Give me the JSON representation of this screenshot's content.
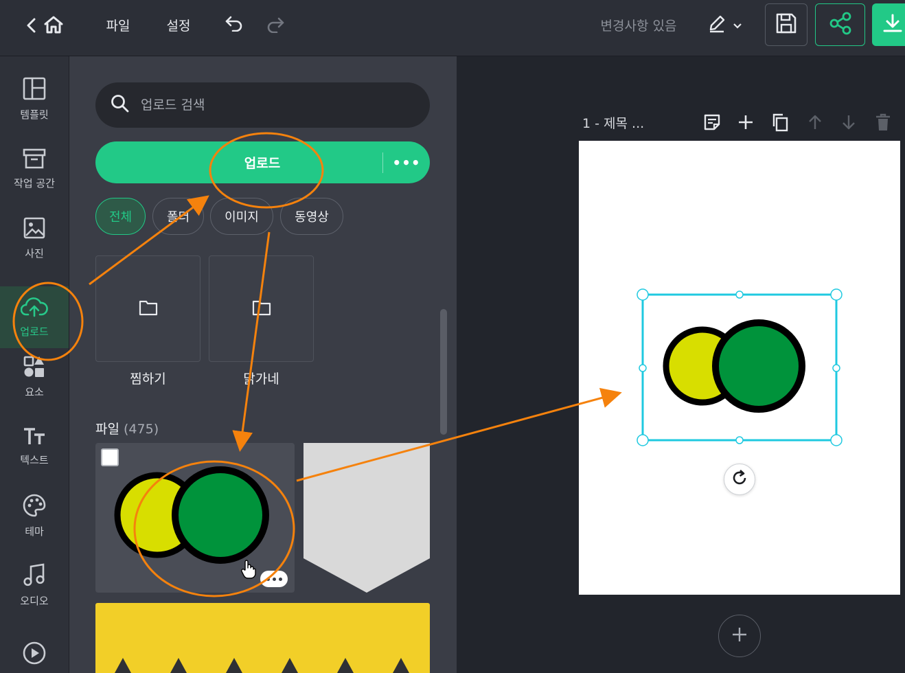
{
  "topbar": {
    "menu_file": "파일",
    "menu_settings": "설정",
    "status": "변경사항 있음"
  },
  "nav": {
    "items": [
      {
        "label": "템플릿",
        "icon": "layout-icon"
      },
      {
        "label": "작업 공간",
        "icon": "archive-icon"
      },
      {
        "label": "사진",
        "icon": "image-icon"
      },
      {
        "label": "업로드",
        "icon": "cloud-upload-icon",
        "active": true
      },
      {
        "label": "요소",
        "icon": "shapes-icon"
      },
      {
        "label": "텍스트",
        "icon": "text-icon"
      },
      {
        "label": "테마",
        "icon": "palette-icon"
      },
      {
        "label": "오디오",
        "icon": "music-icon"
      },
      {
        "label": "",
        "icon": "play-circle-icon"
      }
    ]
  },
  "panel": {
    "search_placeholder": "업로드 검색",
    "upload_label": "업로드",
    "chips": [
      "전체",
      "폴더",
      "이미지",
      "동영상"
    ],
    "folders": [
      "찜하기",
      "닭가네"
    ],
    "files_label": "파일",
    "files_count": "(475)"
  },
  "canvas": {
    "page_label": "1 - 제목 ..."
  },
  "colors": {
    "accent": "#22c987",
    "selection": "#1fc9e0",
    "annotation": "#f5820d",
    "circle_yellow": "#d8de00",
    "circle_green": "#00933b"
  }
}
